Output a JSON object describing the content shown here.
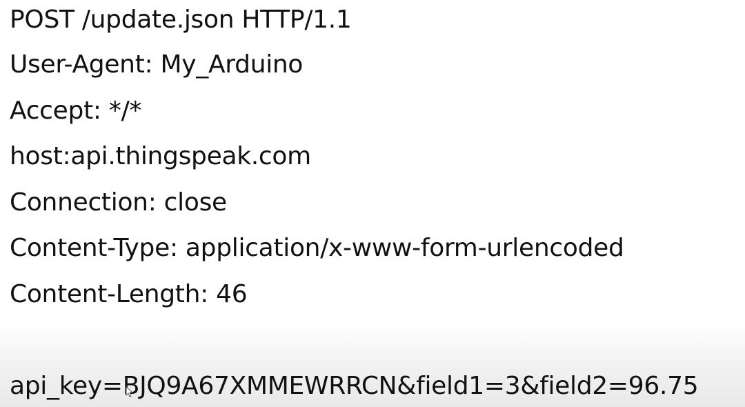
{
  "request": {
    "headers": [
      "POST /update.json HTTP/1.1",
      "User-Agent: My_Arduino",
      "Accept: */*",
      "host:api.thingspeak.com",
      "Connection: close",
      "Content-Type: application/x-www-form-urlencoded",
      "Content-Length: 46"
    ],
    "body": "api_key=BJQ9A67XMMEWRRCN&field1=3&field2=96.75"
  },
  "icons": {
    "cursor": "mouse-pointer-icon"
  }
}
